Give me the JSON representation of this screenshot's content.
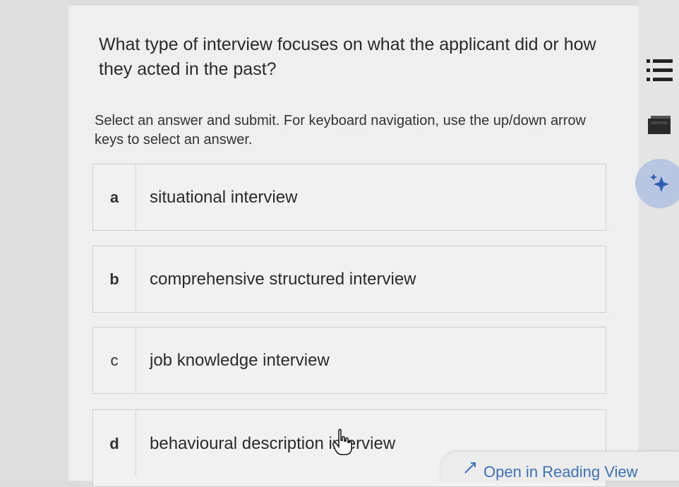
{
  "question": {
    "text": "What type of interview focuses on what the applicant did or how they acted in the past?"
  },
  "instructions": "Select an answer and submit. For keyboard navigation, use the up/down arrow keys to select an answer.",
  "options": [
    {
      "letter": "a",
      "text": "situational interview"
    },
    {
      "letter": "b",
      "text": "comprehensive structured interview"
    },
    {
      "letter": "c",
      "text": "job knowledge interview"
    },
    {
      "letter": "d",
      "text": "behavioural description interview"
    }
  ],
  "sidebar": {
    "icons": [
      "list-icon",
      "book-icon",
      "sparkle-icon"
    ],
    "ai_button_color": "#b9c6e2",
    "sparkle_color": "#2f5fb3"
  },
  "reading_view": {
    "label": "Open in Reading View",
    "icon": "expand-icon",
    "color": "#3d72b8"
  }
}
